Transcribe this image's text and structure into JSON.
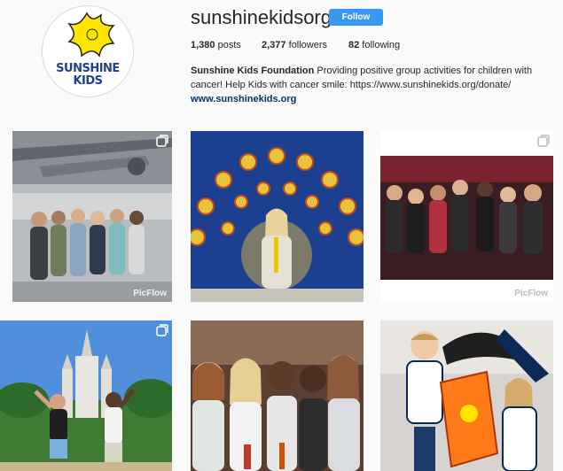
{
  "profile": {
    "username": "sunshinekidsorg",
    "follow_label": "Follow",
    "avatar_logo_line1": "SUNSHINE",
    "avatar_logo_line2": "KIDS",
    "stats": {
      "posts_count": "1,380",
      "posts_label": " posts",
      "followers_count": "2,377",
      "followers_label": " followers",
      "following_count": "82",
      "following_label": " following"
    },
    "bio": {
      "name": "Sunshine Kids Foundation",
      "text": " Providing positive group activities for children with cancer! Help Kids with cancer smile: https://www.sunshinekids.org/donate/",
      "website": "www.sunshinekids.org"
    }
  },
  "posts": [
    {
      "watermark": "PicFlow",
      "multi": true
    },
    {
      "watermark": "",
      "multi": false
    },
    {
      "watermark": "PicFlow",
      "multi": true
    },
    {
      "watermark": "",
      "multi": true
    },
    {
      "watermark": "",
      "multi": false
    },
    {
      "watermark": "",
      "multi": false
    }
  ],
  "colors": {
    "follow_button": "#3897f0",
    "link": "#003569",
    "logo_yellow": "#ffe500",
    "logo_blue": "#1f3f99"
  }
}
